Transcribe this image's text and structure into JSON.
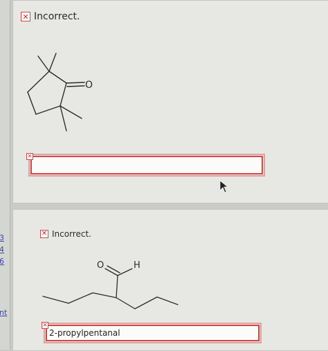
{
  "sidebar": {
    "links": [
      "3",
      "4",
      "6",
      "nt"
    ]
  },
  "question1": {
    "status": "Incorrect.",
    "status_icon": "error-x-icon",
    "atom_label": "O",
    "answer_value": ""
  },
  "question2": {
    "status": "Incorrect.",
    "status_icon": "error-x-icon",
    "atom_labels": {
      "oxygen": "O",
      "hydrogen": "H"
    },
    "answer_value": "2-propylpentanal"
  },
  "colors": {
    "error_red": "#d04848",
    "panel_bg": "#e7e8e3"
  }
}
